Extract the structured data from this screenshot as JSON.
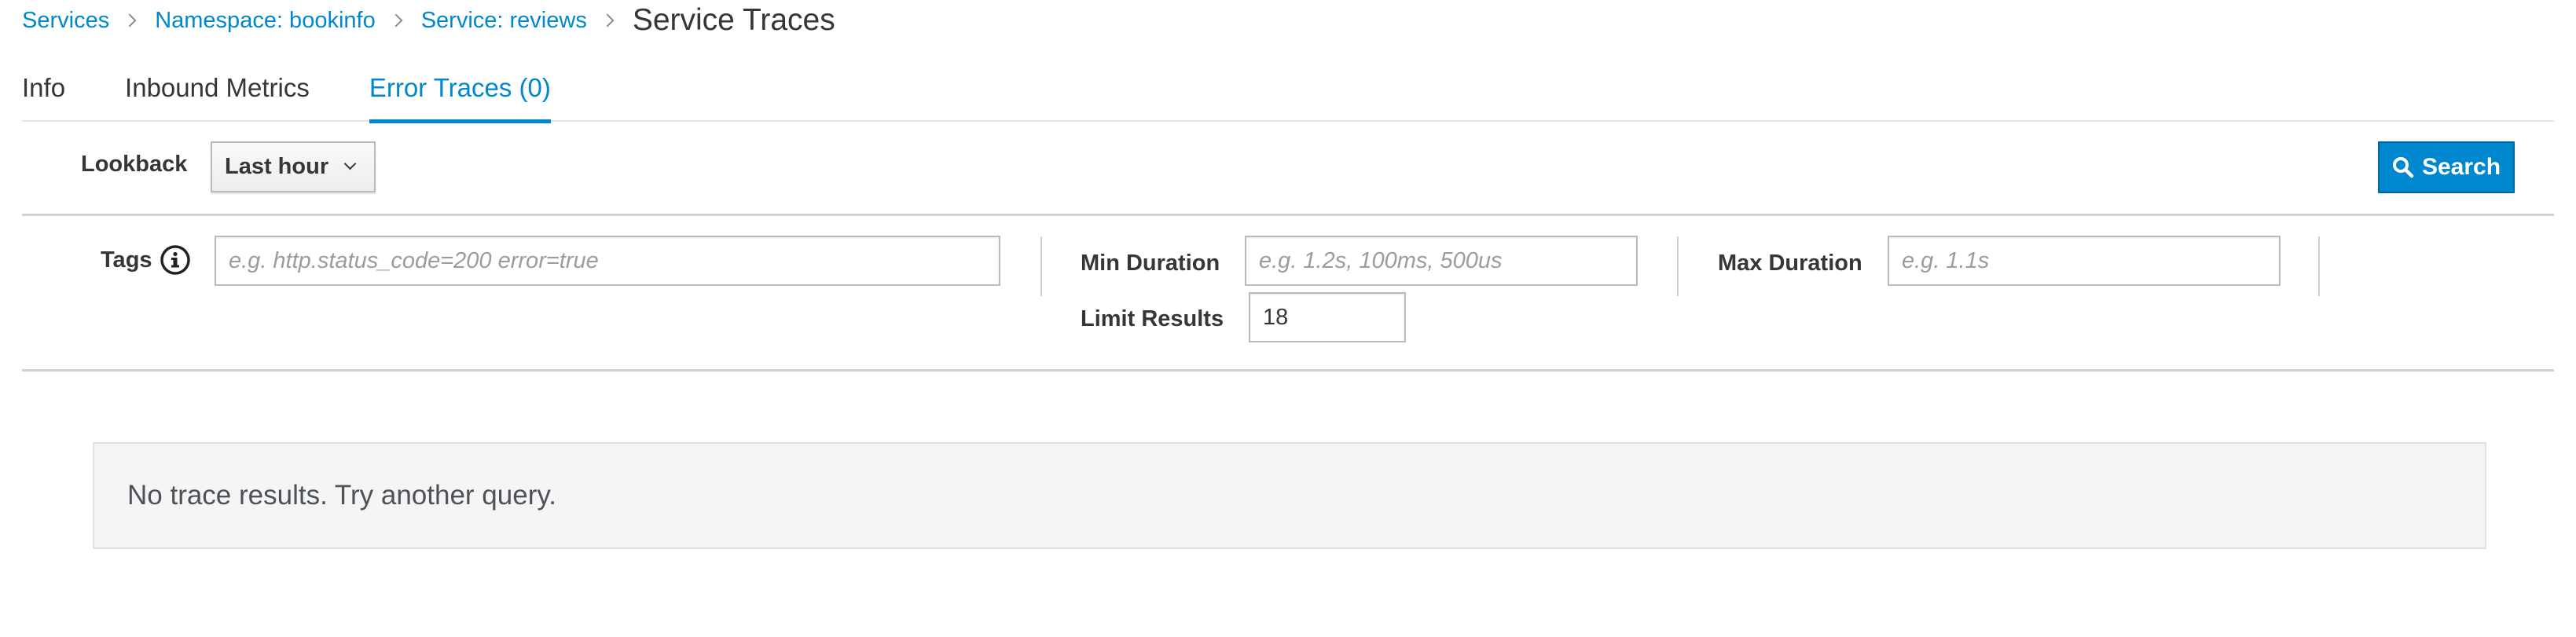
{
  "breadcrumb": {
    "items": [
      "Services",
      "Namespace: bookinfo",
      "Service: reviews"
    ],
    "current": "Service Traces"
  },
  "tabs": [
    {
      "label": "Info",
      "active": false
    },
    {
      "label": "Inbound Metrics",
      "active": false
    },
    {
      "label": "Error Traces (0)",
      "active": true
    }
  ],
  "toolbar": {
    "lookback_label": "Lookback",
    "lookback_value": "Last hour",
    "search_label": "Search"
  },
  "filters": {
    "tags_label": "Tags",
    "tags_placeholder": "e.g. http.status_code=200 error=true",
    "min_duration_label": "Min Duration",
    "min_duration_placeholder": "e.g. 1.2s, 100ms, 500us",
    "max_duration_label": "Max Duration",
    "max_duration_placeholder": "e.g. 1.1s",
    "limit_label": "Limit Results",
    "limit_value": "18"
  },
  "empty_state": {
    "message": "No trace results. Try another query."
  },
  "colors": {
    "accent": "#0088ce",
    "text": "#363636",
    "border": "#d1d1d1"
  },
  "icons": [
    "chevron-right-icon",
    "chevron-down-icon",
    "search-icon",
    "info-icon"
  ]
}
